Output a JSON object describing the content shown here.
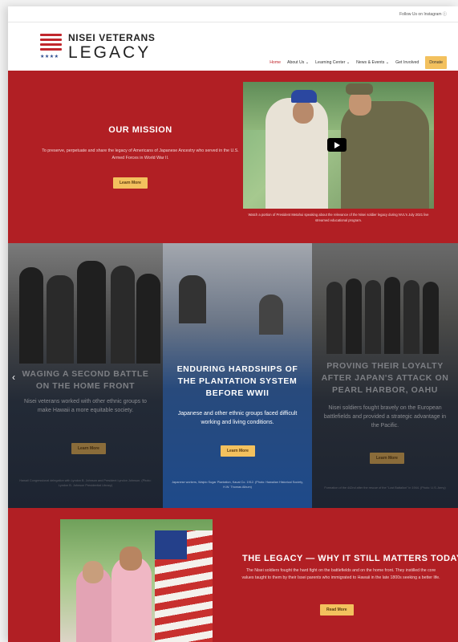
{
  "topbar": {
    "follow_text": "Follow Us on Instagram ⓘ"
  },
  "logo": {
    "line1": "NISEI VETERANS",
    "line2": "LEGACY",
    "stars": "★★★★"
  },
  "nav": {
    "items": [
      {
        "label": "Home"
      },
      {
        "label": "About Us ⌄"
      },
      {
        "label": "Learning Center ⌄"
      },
      {
        "label": "News & Events ⌄"
      },
      {
        "label": "Get Involved"
      }
    ],
    "donate": "Donate"
  },
  "mission": {
    "title": "OUR MISSION",
    "description": "To preserve, perpetuate and share the legacy of Americans of Japanese Ancestry who served in the U.S. Armed Forces in World War II.",
    "button": "Learn More",
    "video_caption": "Watch a portion of President Metahui speaking about the relevance of the Nisei soldier legacy during NVL's July 2021 live streamed educational program."
  },
  "panels": [
    {
      "title": "WAGING A SECOND BATTLE ON THE HOME FRONT",
      "description": "Nisei veterans worked with other ethnic groups to make Hawaii a more equitable society.",
      "button": "Learn More",
      "caption": "Hawaii Congressional delegation with Lyndon B. Johnson and President Lyndon Johnson. (Photo: Lyndon B. Johnson Presidential Library)"
    },
    {
      "title": "ENDURING HARDSHIPS OF THE PLANTATION SYSTEM BEFORE WWII",
      "description": "Japanese and other ethnic groups faced difficult working and living conditions.",
      "button": "Learn More",
      "caption": "Japanese workers, Waipio Sugar Plantation, Kauai Co. 1912. (Photo: Hawaiian Historical Society, H.W. Thomas Album)"
    },
    {
      "title": "PROVING THEIR LOYALTY AFTER JAPAN'S ATTACK ON PEARL HARBOR, OAHU",
      "description": "Nisei soldiers fought bravely on the European battlefields and provided a strategic advantage in the Pacific.",
      "button": "Learn More",
      "caption": "Formation of the 442nd after the rescue of the \"Lost Battalion\" in 1944. (Photo: U.S. Army)"
    }
  ],
  "legacy": {
    "title": "THE LEGACY — WHY IT STILL MATTERS TODAY",
    "description": "The Nisei soldiers fought the hard fight on the battlefields and on the home front. They instilled the core values taught to them by their Issei parents who immigrated to Hawaii in the late 1800s seeking a better life.",
    "button": "Read More"
  },
  "colors": {
    "brand_red": "#b11f24",
    "accent_gold": "#f3c15e",
    "navy": "#1e4a8a"
  }
}
